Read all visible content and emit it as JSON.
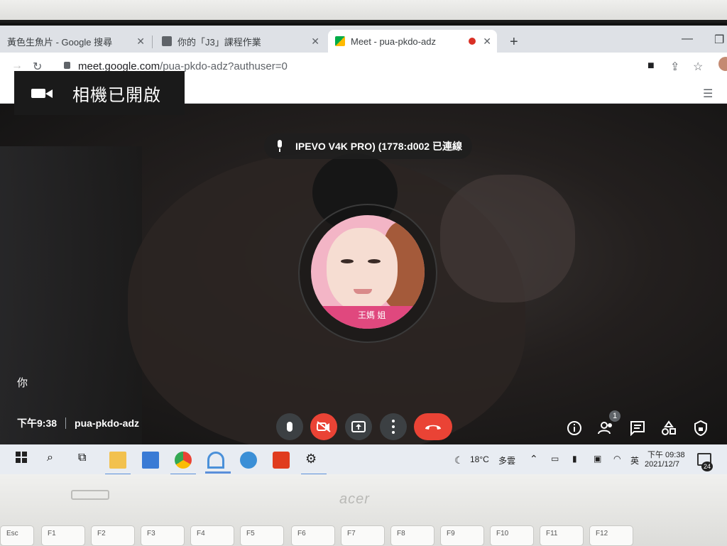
{
  "browser": {
    "tabs": [
      {
        "title": "黃色生魚片 - Google 搜尋"
      },
      {
        "title": "你的「J3」課程作業"
      },
      {
        "title": "Meet - pua-pkdo-adz"
      }
    ],
    "url_host": "meet.google.com",
    "url_rest": "/pua-pkdo-adz?authuser=0"
  },
  "meet": {
    "camera_toast": "相機已開啟",
    "mic_device": "IPEVO V4K PRO) (1778:d002 已連線",
    "self_label": "你",
    "time": "下午9:38",
    "meeting_code": "pua-pkdo-adz",
    "participants_count": "1",
    "avatar_strip_text": "王媽 姐"
  },
  "taskbar": {
    "weather_temp": "18°C",
    "weather_text": "多雲",
    "ime": "英",
    "clock_time": "下午 09:38",
    "clock_date": "2021/12/7",
    "notification_count": "24"
  },
  "laptop": {
    "brand": "acer",
    "keys": [
      "Esc",
      "F1",
      "F2",
      "F3",
      "F4",
      "F5",
      "F6",
      "F7",
      "F8",
      "F9",
      "F10",
      "F11",
      "F12"
    ]
  },
  "colors": {
    "hangup_red": "#ea4335",
    "control_grey": "#3c4043",
    "tab_strip": "#dee1e6",
    "taskbar": "#e8ecf2"
  }
}
